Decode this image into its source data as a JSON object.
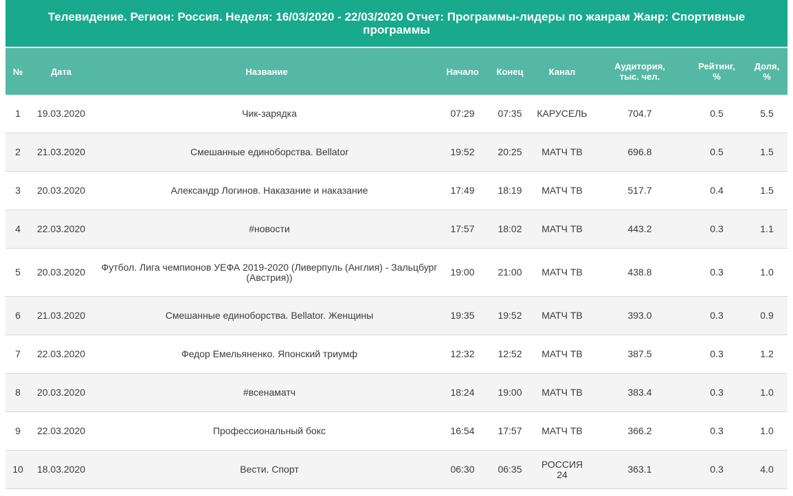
{
  "report": {
    "title": "Телевидение. Регион: Россия. Неделя: 16/03/2020 - 22/03/2020 Отчет: Программы-лидеры по жанрам Жанр: Спортивные программы"
  },
  "table": {
    "headers": {
      "num": "№",
      "date": "Дата",
      "name": "Название",
      "start": "Начало",
      "end": "Конец",
      "channel": "Канал",
      "audience": "Аудитория, тыс. чел.",
      "rating": "Рейтинг, %",
      "share": "Доля, %"
    },
    "rows": [
      {
        "num": "1",
        "date": "19.03.2020",
        "name": "Чик-зарядка",
        "start": "07:29",
        "end": "07:35",
        "channel": "КАРУСЕЛЬ",
        "audience": "704.7",
        "rating": "0.5",
        "share": "5.5"
      },
      {
        "num": "2",
        "date": "21.03.2020",
        "name": "Смешанные единоборства. Bellator",
        "start": "19:52",
        "end": "20:25",
        "channel": "МАТЧ ТВ",
        "audience": "696.8",
        "rating": "0.5",
        "share": "1.5"
      },
      {
        "num": "3",
        "date": "20.03.2020",
        "name": "Александр Логинов. Наказание и наказание",
        "start": "17:49",
        "end": "18:19",
        "channel": "МАТЧ ТВ",
        "audience": "517.7",
        "rating": "0.4",
        "share": "1.5"
      },
      {
        "num": "4",
        "date": "22.03.2020",
        "name": "#новости",
        "start": "17:57",
        "end": "18:02",
        "channel": "МАТЧ ТВ",
        "audience": "443.2",
        "rating": "0.3",
        "share": "1.1"
      },
      {
        "num": "5",
        "date": "20.03.2020",
        "name": "Футбол. Лига чемпионов УЕФА 2019-2020 (Ливерпуль (Англия) - Зальцбург (Австрия))",
        "start": "19:00",
        "end": "21:00",
        "channel": "МАТЧ ТВ",
        "audience": "438.8",
        "rating": "0.3",
        "share": "1.0"
      },
      {
        "num": "6",
        "date": "21.03.2020",
        "name": "Смешанные единоборства. Bellator. Женщины",
        "start": "19:35",
        "end": "19:52",
        "channel": "МАТЧ ТВ",
        "audience": "393.0",
        "rating": "0.3",
        "share": "0.9"
      },
      {
        "num": "7",
        "date": "22.03.2020",
        "name": "Федор Емельяненко. Японский триумф",
        "start": "12:32",
        "end": "12:52",
        "channel": "МАТЧ ТВ",
        "audience": "387.5",
        "rating": "0.3",
        "share": "1.2"
      },
      {
        "num": "8",
        "date": "20.03.2020",
        "name": "#всенаматч",
        "start": "18:24",
        "end": "19:00",
        "channel": "МАТЧ ТВ",
        "audience": "383.4",
        "rating": "0.3",
        "share": "1.0"
      },
      {
        "num": "9",
        "date": "22.03.2020",
        "name": "Профессиональный бокс",
        "start": "16:54",
        "end": "17:57",
        "channel": "МАТЧ ТВ",
        "audience": "366.2",
        "rating": "0.3",
        "share": "1.0"
      },
      {
        "num": "10",
        "date": "18.03.2020",
        "name": "Вести. Спорт",
        "start": "06:30",
        "end": "06:35",
        "channel": "РОССИЯ 24",
        "audience": "363.1",
        "rating": "0.3",
        "share": "4.0"
      }
    ]
  },
  "colors": {
    "title_bg": "#19a98d",
    "header_bg": "#55b8a4",
    "row_alt_bg": "#f4f4f4",
    "text": "#3a3a3a"
  }
}
